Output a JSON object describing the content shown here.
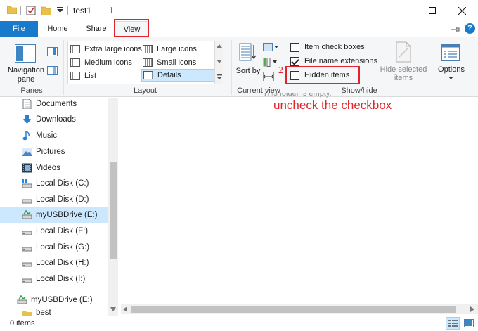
{
  "window": {
    "title": "test1",
    "minimize_glyph": "—",
    "maximize_glyph": "☐",
    "close_glyph": "✕"
  },
  "tabs": {
    "file": "File",
    "home": "Home",
    "share": "Share",
    "view": "View"
  },
  "ribbon": {
    "panes": {
      "navigation_pane": "Navigation pane",
      "group_label": "Panes"
    },
    "layout": {
      "items": [
        {
          "label": "Extra large icons",
          "icon": "extra-large-icons-icon"
        },
        {
          "label": "Large icons",
          "icon": "large-icons-icon"
        },
        {
          "label": "Medium icons",
          "icon": "medium-icons-icon"
        },
        {
          "label": "Small icons",
          "icon": "small-icons-icon"
        },
        {
          "label": "List",
          "icon": "list-icon"
        },
        {
          "label": "Details",
          "icon": "details-icon",
          "selected": true
        }
      ],
      "group_label": "Layout"
    },
    "current_view": {
      "sort_by": "Sort by",
      "group_label": "Current view"
    },
    "show_hide": {
      "item_check_boxes": {
        "label": "Item check boxes",
        "checked": false
      },
      "file_name_extensions": {
        "label": "File name extensions",
        "checked": true
      },
      "hidden_items": {
        "label": "Hidden items",
        "checked": false
      },
      "hide_selected_items": "Hide selected items",
      "group_label": "Show/hide"
    },
    "options": "Options"
  },
  "annotations": {
    "step1": "1",
    "step2": "2",
    "instruction": "uncheck the checkbox"
  },
  "navigation": {
    "items": [
      {
        "label": "Documents",
        "icon": "documents-icon"
      },
      {
        "label": "Downloads",
        "icon": "downloads-icon"
      },
      {
        "label": "Music",
        "icon": "music-icon"
      },
      {
        "label": "Pictures",
        "icon": "pictures-icon"
      },
      {
        "label": "Videos",
        "icon": "videos-icon"
      },
      {
        "label": "Local Disk (C:)",
        "icon": "windows-drive-icon"
      },
      {
        "label": "Local Disk (D:)",
        "icon": "drive-icon"
      },
      {
        "label": "myUSBDrive (E:)",
        "icon": "usb-drive-icon",
        "selected": true
      },
      {
        "label": "Local Disk (F:)",
        "icon": "drive-icon"
      },
      {
        "label": "Local Disk (G:)",
        "icon": "drive-icon"
      },
      {
        "label": "Local Disk (H:)",
        "icon": "drive-icon"
      },
      {
        "label": "Local Disk (I:)",
        "icon": "drive-icon"
      },
      {
        "label": "myUSBDrive (E:)",
        "icon": "usb-drive-icon"
      },
      {
        "label": "best",
        "icon": "folder-icon"
      }
    ]
  },
  "content": {
    "empty_message": "This folder is empty."
  },
  "status": {
    "item_count": "0 items"
  },
  "colors": {
    "accent": "#1979ca",
    "annotation_red": "#e0262c",
    "selection": "#cce8ff"
  }
}
